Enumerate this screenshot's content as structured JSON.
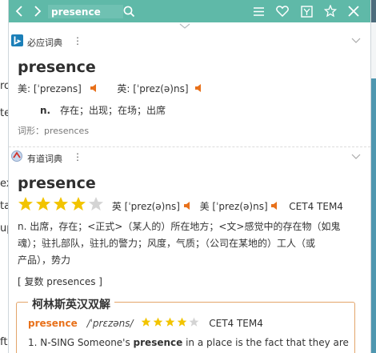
{
  "background": {
    "left_fragments": [
      "ro",
      "te",
      "ex",
      "ta",
      "up",
      "ft"
    ]
  },
  "toolbar": {
    "search_value": "presence",
    "icons": [
      "back-icon",
      "forward-icon",
      "search-icon",
      "menu-icon",
      "heart-icon",
      "anki-icon",
      "pin-icon",
      "close-icon"
    ]
  },
  "bing": {
    "name": "必应词典",
    "word": "presence",
    "us_label": "美:",
    "us_phonetic": "[ˈprezəns]",
    "uk_label": "英:",
    "uk_phonetic": "[ˈprez(ə)ns]",
    "pos": "n.",
    "definition": "存在；出现；在场；出席",
    "forms": "词形：presences"
  },
  "youdao": {
    "name": "有道词典",
    "word": "presence",
    "star_rating": 4,
    "star_max": 5,
    "uk_label": "英",
    "uk_phonetic": "[ˈprez(ə)ns]",
    "us_label": "美",
    "us_phonetic": "[ˈprez(ə)ns]",
    "tags": "CET4 TEM4",
    "definition_line1": "n. 出席，存在；<正式>（某人的）所在地方；<文>感觉中的存在物（如鬼",
    "definition_line2": "魂）；驻扎部队，驻扎的警力；风度，气质；（公司在某地的）工人（或",
    "definition_line3": "产品），势力",
    "plural": "[ 复数 presences ]"
  },
  "collins": {
    "title": "柯林斯英汉双解",
    "word": "presence",
    "phonetic": "/ˈprɛzəns/",
    "star_rating": 4,
    "star_max": 5,
    "tags": "CET4 TEM4",
    "example_prefix": "1. N-SING Someone's ",
    "example_bold": "presence",
    "example_suffix": " in a place is the fact that they are"
  },
  "colors": {
    "toolbar": "#5fb9a8",
    "star": "#f2c400",
    "star_empty": "#d4d4d4",
    "speaker": "#e8711b",
    "collins_border": "#e3a56a",
    "collins_word": "#e8711b"
  }
}
